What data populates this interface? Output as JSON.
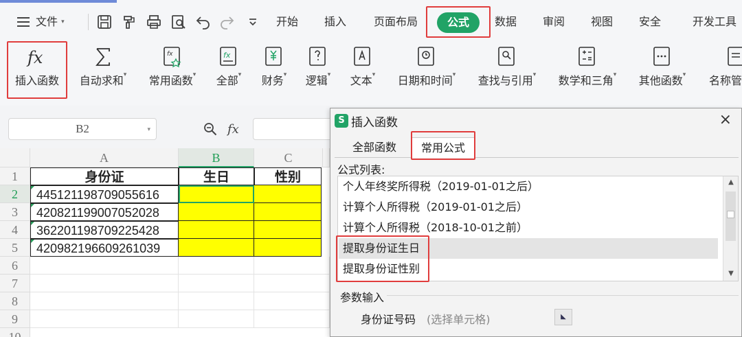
{
  "menu": {
    "file": "文件",
    "tabs": [
      "开始",
      "插入",
      "页面布局",
      "公式",
      "数据",
      "审阅",
      "视图",
      "安全",
      "开发工具"
    ],
    "active_tab": "公式"
  },
  "ribbon": {
    "insert_function": "插入函数",
    "autosum": "自动求和",
    "common": "常用函数",
    "all": "全部",
    "finance": "财务",
    "logic": "逻辑",
    "text": "文本",
    "datetime": "日期和时间",
    "lookup": "查找与引用",
    "math": "数学和三角",
    "other": "其他函数",
    "name": "名称管"
  },
  "formula_bar": {
    "name_box": "B2"
  },
  "sheet": {
    "columns": [
      "A",
      "B",
      "C"
    ],
    "rows": [
      "1",
      "2",
      "3",
      "4",
      "5",
      "6",
      "7",
      "8",
      "9",
      "10"
    ],
    "headers": [
      "身份证",
      "生日",
      "性别"
    ],
    "ids": [
      "445121198709055616",
      "420821199007052028",
      "362201198709225428",
      "420982196609261039"
    ]
  },
  "dialog": {
    "title": "插入函数",
    "close": "×",
    "tab_all": "全部函数",
    "tab_common": "常用公式",
    "list_label": "公式列表:",
    "items": [
      "个人年终奖所得税（2019-01-01之后）",
      "计算个人所得税（2019-01-01之后）",
      "计算个人所得税（2018-10-01之前）",
      "提取身份证生日",
      "提取身份证性别"
    ],
    "param_title": "参数输入",
    "param_label": "身份证号码",
    "param_placeholder": "(选择单元格)"
  },
  "colors": {
    "accent": "#21a366",
    "highlight_box": "#e03c3c",
    "fill_yellow": "#ffff00"
  }
}
